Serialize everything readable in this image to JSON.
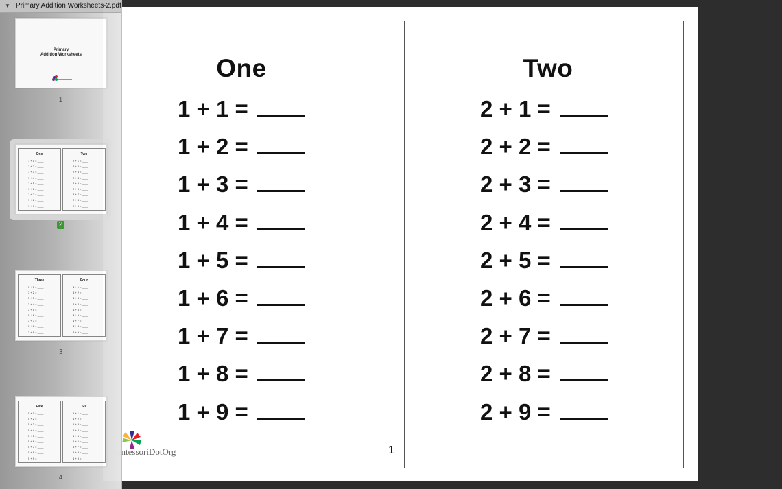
{
  "sidebar": {
    "document_title": "Primary Addition Worksheets-2.pdf",
    "thumbnails": [
      {
        "page": "1",
        "cover_title_line1": "Primary",
        "cover_title_line2": "Addition Worksheets"
      },
      {
        "page": "2",
        "left_title": "One",
        "right_title": "Two"
      },
      {
        "page": "3",
        "left_title": "Three",
        "right_title": "Four"
      },
      {
        "page": "4",
        "left_title": "Five",
        "right_title": "Six"
      }
    ],
    "selected_page": "2"
  },
  "page": {
    "left_sheet": {
      "title": "One",
      "problems": [
        "1 + 1 =",
        "1 + 2 =",
        "1 + 3 =",
        "1 + 4 =",
        "1 + 5 =",
        "1 + 6 =",
        "1 + 7 =",
        "1 + 8 =",
        "1 + 9 ="
      ]
    },
    "right_sheet": {
      "title": "Two",
      "problems": [
        "2 + 1 =",
        "2 + 2 =",
        "2 + 3 =",
        "2 + 4 =",
        "2 + 5 =",
        "2 + 6 =",
        "2 + 7 =",
        "2 + 8 =",
        "2 + 9 ="
      ]
    },
    "page_number": "1",
    "logo_text": "ontessoriDotOrg"
  },
  "colors": {
    "background": "#2d2d2d",
    "selected_badge": "#3d9b35",
    "logo_petals": [
      "#2e3192",
      "#e31e24",
      "#00a651",
      "#fcb040",
      "#8dc63f",
      "#92278f"
    ]
  }
}
